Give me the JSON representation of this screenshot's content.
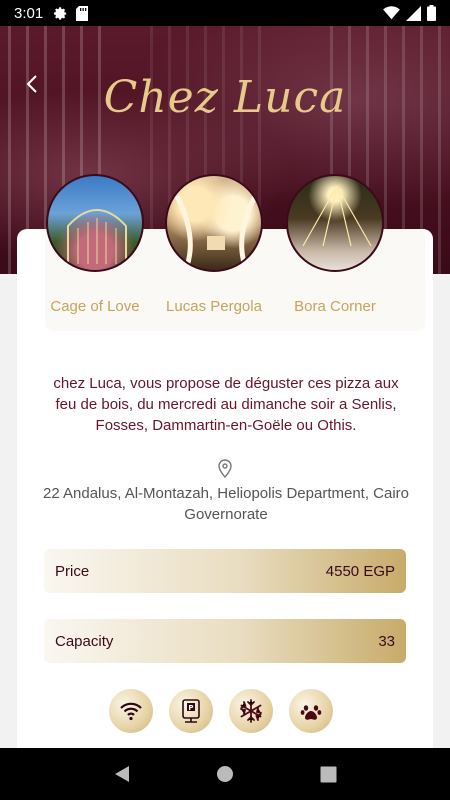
{
  "status": {
    "time": "3:01"
  },
  "header": {
    "title": "Chez Luca"
  },
  "categories": [
    {
      "label": "Cage of Love"
    },
    {
      "label": "Lucas Pergola"
    },
    {
      "label": "Bora Corner"
    }
  ],
  "description": "chez Luca, vous propose de déguster ces pizza aux feu de bois, du mercredi au dimanche soir a Senlis, Fosses, Dammartin-en-Goële ou Othis.",
  "address": "22 Andalus, Al-Montazah, Heliopolis Department, Cairo Governorate",
  "details": {
    "price_label": "Price",
    "price_value": "4550 EGP",
    "capacity_label": "Capacity",
    "capacity_value": "33"
  },
  "amenities": [
    {
      "icon": "wifi-icon"
    },
    {
      "icon": "parking-icon"
    },
    {
      "icon": "air-conditioning-icon"
    },
    {
      "icon": "pets-allowed-icon"
    }
  ],
  "colors": {
    "header_bg": "#4a1020",
    "title_gold": "#e7c98a",
    "category_label": "#c9a35a",
    "description_text": "#6a1428",
    "row_gradient_end": "#c7ab6a"
  }
}
